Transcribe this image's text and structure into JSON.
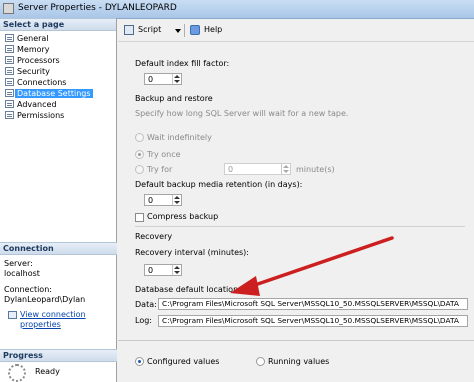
{
  "window": {
    "title": "Server Properties - DYLANLEOPARD"
  },
  "left_panel": {
    "select_page_header": "Select a page",
    "pages": [
      "General",
      "Memory",
      "Processors",
      "Security",
      "Connections",
      "Database Settings",
      "Advanced",
      "Permissions"
    ],
    "selected_page": "Database Settings",
    "connection": {
      "header": "Connection",
      "server_label": "Server:",
      "server_value": "localhost",
      "connection_label": "Connection:",
      "connection_value": "DylanLeopard\\Dylan",
      "view_link": "View connection properties"
    },
    "progress": {
      "header": "Progress",
      "status": "Ready"
    }
  },
  "toolbar": {
    "script_label": "Script",
    "help_label": "Help"
  },
  "main": {
    "fill_factor_label": "Default index fill factor:",
    "fill_factor_value": "0",
    "backup_restore_header": "Backup and restore",
    "backup_hint": "Specify how long SQL Server will wait for a new tape.",
    "wait_indefinitely": "Wait indefinitely",
    "try_once": "Try once",
    "try_for": "Try for",
    "try_for_value": "0",
    "minutes_suffix": "minute(s)",
    "retention_label": "Default backup media retention (in days):",
    "retention_value": "0",
    "compress_backup": "Compress backup",
    "recovery_header": "Recovery",
    "recovery_interval_label": "Recovery interval (minutes):",
    "recovery_interval_value": "0",
    "db_locations_header": "Database default locations",
    "data_label": "Data:",
    "data_path": "C:\\Program Files\\Microsoft SQL Server\\MSSQL10_50.MSSQLSERVER\\MSSQL\\DATA",
    "log_label": "Log:",
    "log_path": "C:\\Program Files\\Microsoft SQL Server\\MSSQL10_50.MSSQLSERVER\\MSSQL\\DATA",
    "configured_values": "Configured values",
    "running_values": "Running values"
  },
  "colors": {
    "selection": "#3399ff",
    "annotation_arrow": "#cc1f1f",
    "link": "#0645ad"
  },
  "icons": [
    "app-icon",
    "page-icon",
    "script-icon",
    "dropdown-arrow-icon",
    "help-icon",
    "connection-properties-icon",
    "progress-spinner-icon"
  ]
}
